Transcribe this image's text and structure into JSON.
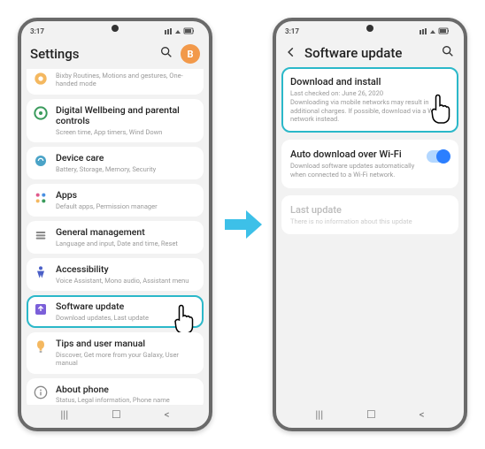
{
  "status": {
    "time": "3:17",
    "iconsLabel": "signal wifi battery"
  },
  "phone1": {
    "headerTitle": "Settings",
    "avatarLetter": "B",
    "items": [
      {
        "icon": "bixby",
        "title": "",
        "sub": "Bixby Routines, Motions and gestures, One-handed mode"
      },
      {
        "icon": "wellbeing",
        "title": "Digital Wellbeing and parental controls",
        "sub": "Screen time, App timers, Wind Down"
      },
      {
        "icon": "device",
        "title": "Device care",
        "sub": "Battery, Storage, Memory, Security"
      },
      {
        "icon": "apps",
        "title": "Apps",
        "sub": "Default apps, Permission manager"
      },
      {
        "icon": "general",
        "title": "General management",
        "sub": "Language and input, Date and time, Reset"
      },
      {
        "icon": "accessibility",
        "title": "Accessibility",
        "sub": "Voice Assistant, Mono audio, Assistant menu"
      },
      {
        "icon": "software",
        "title": "Software update",
        "sub": "Download updates, Last update"
      },
      {
        "icon": "tips",
        "title": "Tips and user manual",
        "sub": "Discover, Get more from your Galaxy, User manual"
      },
      {
        "icon": "about",
        "title": "About phone",
        "sub": "Status, Legal information, Phone name"
      }
    ]
  },
  "phone2": {
    "headerTitle": "Software update",
    "items": [
      {
        "title": "Download and install",
        "sub": "Last checked on: June 26, 2020\nDownloading via mobile networks may result in additional charges. If possible, download via a Wi-Fi network instead."
      },
      {
        "title": "Auto download over Wi-Fi",
        "sub": "Download software updates automatically when connected to a Wi-Fi network.",
        "toggle": true
      },
      {
        "title": "Last update",
        "sub": "There is no information about this update",
        "faded": true
      }
    ]
  }
}
